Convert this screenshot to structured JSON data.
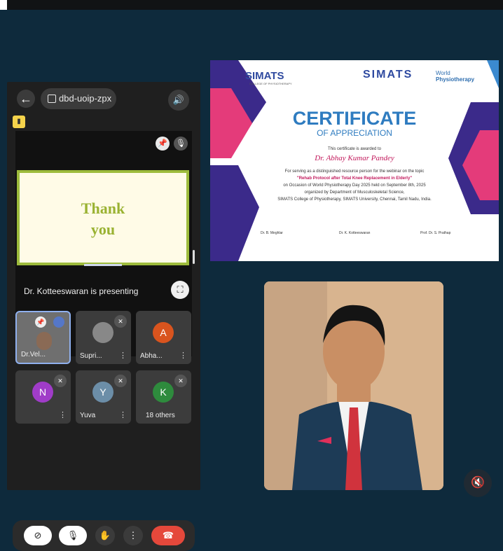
{
  "meet": {
    "meeting_code": "dbd-uoip-zpx",
    "presenting_text": "Dr. Kotteeswaran is presenting",
    "slide_text_line1": "Thank",
    "slide_text_line2": "you",
    "participants": [
      {
        "name": "Dr.Vel...",
        "initial": "",
        "color": "#6f6f6f"
      },
      {
        "name": "Supri...",
        "initial": "",
        "color": "#3c3c3c"
      },
      {
        "name": "Abha...",
        "initial": "A",
        "color": "#d9541e"
      },
      {
        "name": "",
        "initial": "N",
        "color": "#a03cc8"
      },
      {
        "name": "Yuva",
        "initial": "Y",
        "color": "#6c8ea8"
      },
      {
        "name": "18 others",
        "initial": "K",
        "color": "#2e8b3d"
      }
    ]
  },
  "certificate": {
    "logo_left": "SIMATS",
    "logo_left_sub": "COLLEGE OF PHYSIOTHERAPY",
    "logo_center": "SIMATS",
    "logo_right_line1": "World",
    "logo_right_line2": "Physiotherapy",
    "title": "CERTIFICATE",
    "subtitle": "OF APPRECIATION",
    "awarded_to": "This certificate is awarded to",
    "recipient": "Dr. Abhay Kumar Pandey",
    "line1": "For serving as a distinguished resource person for the webinar on the topic",
    "topic": "\"Rehab Protocol after Total Knee Replacement in Elderly\"",
    "line3": "on Occasion of World Physiotherapy Day 2025 held on September 8th, 2025",
    "line4": "organized by Department of Musculoskeletal Science,",
    "line5": "SIMATS College of Physiotherapy, SIMATS University, Chennai, Tamil Nadu, India.",
    "sign1": "Dr. B. Meghlar",
    "sign2": "Dr. K. Kotteeswaran",
    "sign3": "Prof. Dr. S. Prathap"
  }
}
